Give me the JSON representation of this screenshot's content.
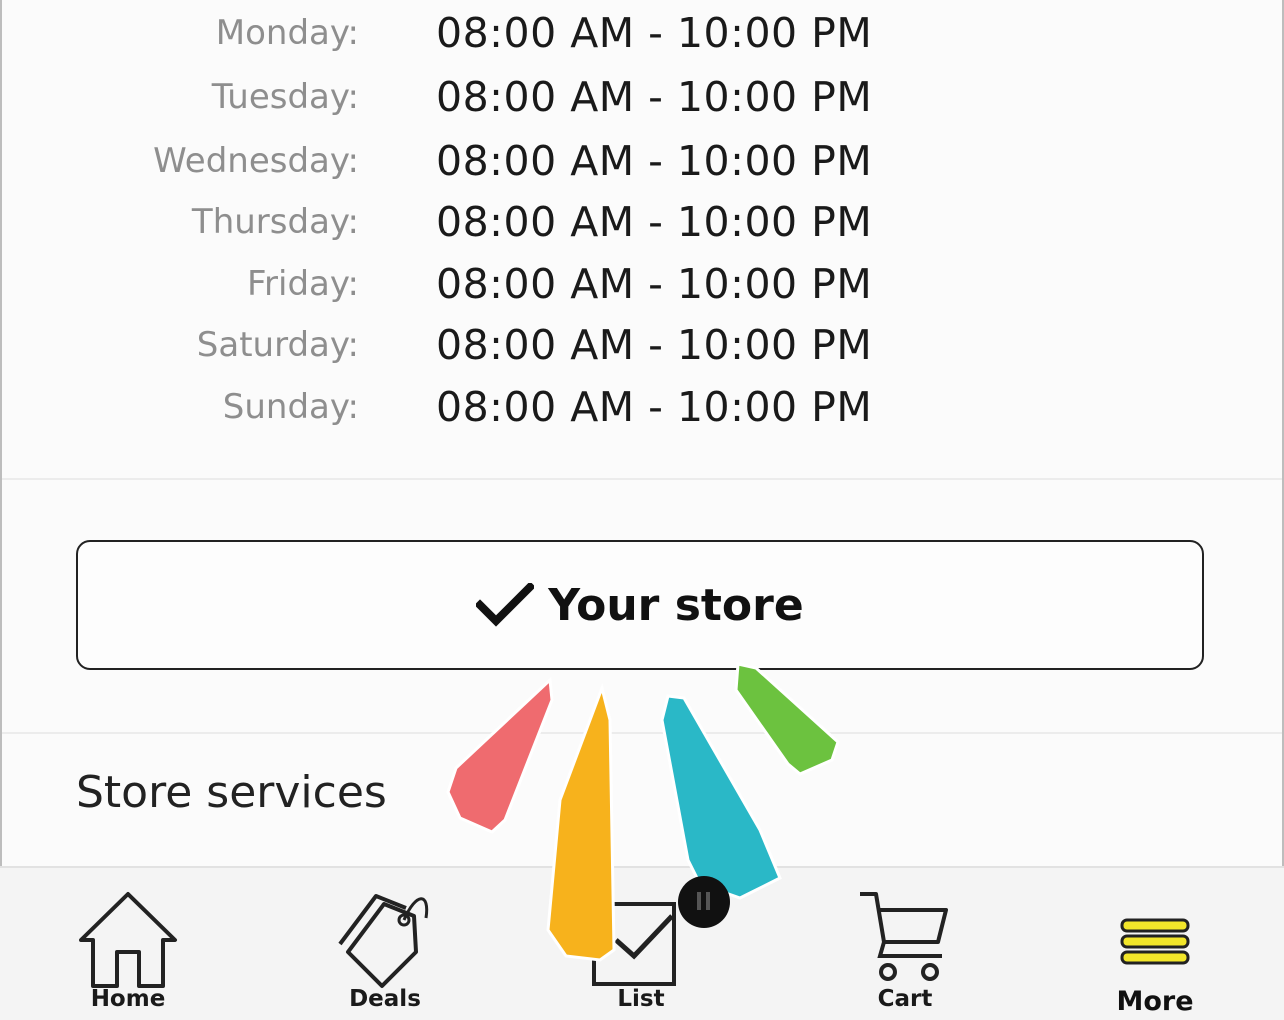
{
  "hours": [
    {
      "day": "Monday:",
      "time": "08:00 AM - 10:00 PM"
    },
    {
      "day": "Tuesday:",
      "time": "08:00 AM - 10:00 PM"
    },
    {
      "day": "Wednesday:",
      "time": "08:00 AM - 10:00 PM"
    },
    {
      "day": "Thursday:",
      "time": "08:00 AM - 10:00 PM"
    },
    {
      "day": "Friday:",
      "time": "08:00 AM - 10:00 PM"
    },
    {
      "day": "Saturday:",
      "time": "08:00 AM - 10:00 PM"
    },
    {
      "day": "Sunday:",
      "time": "08:00 AM - 10:00 PM"
    }
  ],
  "store_button": {
    "label": "Your store",
    "icon": "checkmark-icon"
  },
  "store_services": {
    "label": "Store services"
  },
  "tabbar": {
    "items": [
      {
        "label": "Home",
        "icon": "home-icon"
      },
      {
        "label": "Deals",
        "icon": "tag-icon"
      },
      {
        "label": "List",
        "icon": "checklist-icon"
      },
      {
        "label": "Cart",
        "icon": "cart-icon"
      },
      {
        "label": "More",
        "icon": "menu-icon"
      }
    ]
  },
  "colors": {
    "accent_yellow": "#f2e62a",
    "confetti_red": "#ef6b6f",
    "confetti_orange": "#f7b21c",
    "confetti_teal": "#2ab8c7",
    "confetti_green": "#6cc23f"
  }
}
